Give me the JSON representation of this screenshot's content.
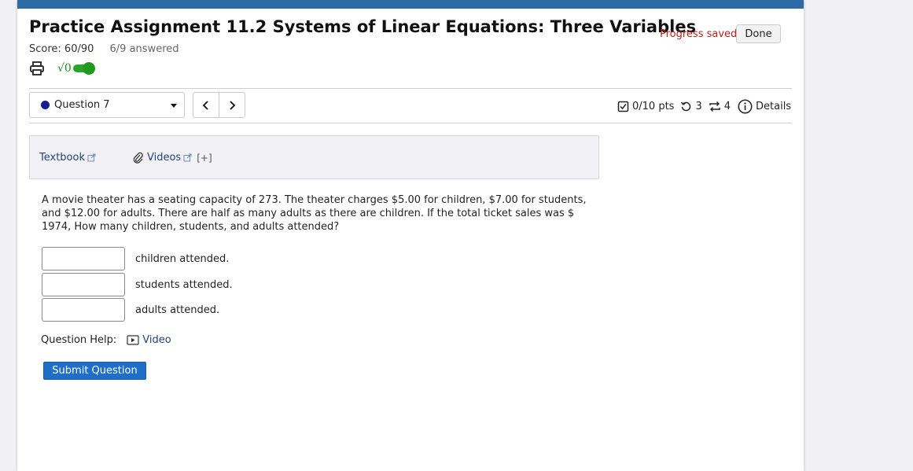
{
  "header": {
    "title": "Practice Assignment 11.2 Systems of Linear Equations: Three Variables",
    "score": "Score: 60/90",
    "answered": "6/9 answered",
    "progress_saved": "Progress saved",
    "done_label": "Done",
    "math_toggle_label": "√0",
    "math_toggle_on": true
  },
  "nav": {
    "question_select_value": "Question 7",
    "prev_label": "‹",
    "next_label": "›"
  },
  "question_info": {
    "points": "0/10 pts",
    "retries": "3",
    "attempts": "4",
    "details_label": "Details"
  },
  "resources": {
    "textbook_label": "Textbook",
    "videos_label": "Videos",
    "expand_label": "[+]"
  },
  "problem": {
    "text": "A movie theater has a seating capacity of 273. The theater charges $5.00 for children, $7.00 for students, and $12.00 for adults. There are half as many adults as there are children. If the total ticket sales was $ 1974, How many children, students, and adults attended?"
  },
  "answers": [
    {
      "label": "children attended.",
      "value": ""
    },
    {
      "label": "students attended.",
      "value": ""
    },
    {
      "label": "adults attended.",
      "value": ""
    }
  ],
  "help": {
    "label": "Question Help:",
    "video_label": "Video"
  },
  "submit_label": "Submit Question",
  "colors": {
    "topbar": "#2d6aa6",
    "progress_saved": "#b3261e",
    "submit": "#1f6fc9",
    "toggle": "#2aa52a",
    "question_dot": "#131f8a",
    "link": "#23457a"
  },
  "icons": [
    "printer-icon",
    "checkbox-icon",
    "retry-icon",
    "attempts-icon",
    "info-icon",
    "external-link-icon",
    "paperclip-icon",
    "video-icon"
  ]
}
